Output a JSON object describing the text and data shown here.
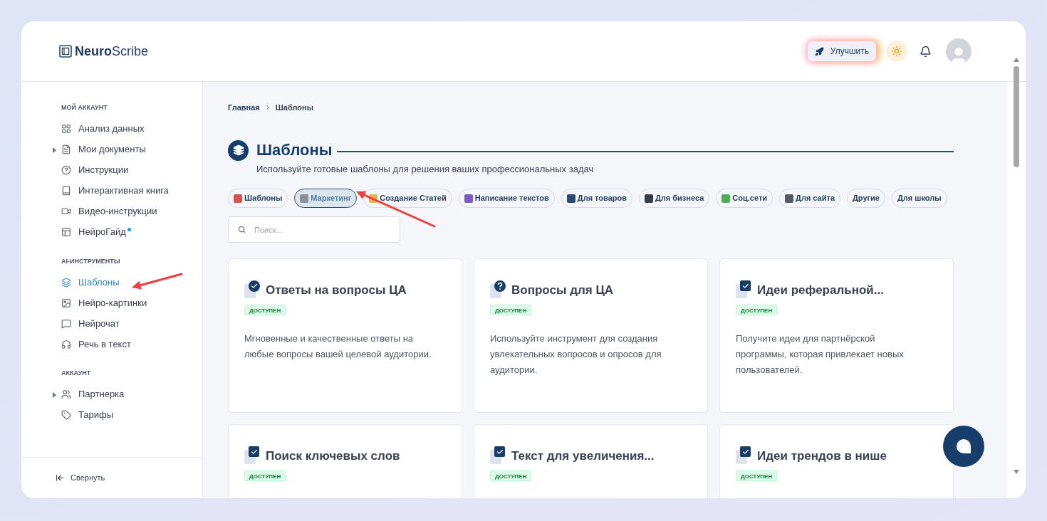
{
  "logo": {
    "bold": "Neuro",
    "light": "Scribe"
  },
  "header": {
    "upgrade_label": "Улучшить"
  },
  "sidebar": {
    "sections": [
      {
        "title": "МОЙ АККАУНТ",
        "items": [
          {
            "label": "Анализ данных",
            "kind": "grid",
            "selected": false,
            "expandable": false,
            "new_dot": false
          },
          {
            "label": "Мои документы",
            "kind": "file",
            "selected": false,
            "expandable": true,
            "new_dot": false
          },
          {
            "label": "Инструкции",
            "kind": "help",
            "selected": false,
            "expandable": false,
            "new_dot": false
          },
          {
            "label": "Интерактивная книга",
            "kind": "book",
            "selected": false,
            "expandable": false,
            "new_dot": false
          },
          {
            "label": "Видео-инструкции",
            "kind": "video",
            "selected": false,
            "expandable": false,
            "new_dot": false
          },
          {
            "label": "НейроГайд",
            "kind": "panel",
            "selected": false,
            "expandable": false,
            "new_dot": true
          }
        ]
      },
      {
        "title": "AI-ИНСТРУМЕНТЫ",
        "items": [
          {
            "label": "Шаблоны",
            "kind": "layers",
            "selected": true,
            "expandable": false,
            "new_dot": false
          },
          {
            "label": "Нейро-картинки",
            "kind": "image",
            "selected": false,
            "expandable": false,
            "new_dot": false
          },
          {
            "label": "Нейрочат",
            "kind": "chat",
            "selected": false,
            "expandable": false,
            "new_dot": false
          },
          {
            "label": "Речь в текст",
            "kind": "headphones",
            "selected": false,
            "expandable": false,
            "new_dot": false
          }
        ]
      },
      {
        "title": "АККАУНТ",
        "items": [
          {
            "label": "Партнерка",
            "kind": "users",
            "selected": false,
            "expandable": true,
            "new_dot": false
          },
          {
            "label": "Тарифы",
            "kind": "tag",
            "selected": false,
            "expandable": false,
            "new_dot": false
          }
        ]
      }
    ],
    "collapse_label": "Свернуть"
  },
  "breadcrumb": [
    "Главная",
    "Шаблоны"
  ],
  "page": {
    "title": "Шаблоны",
    "subtitle": "Используйте готовые шаблоны для решения ваших профессиональных задач"
  },
  "categories": [
    {
      "label": "Шаблоны",
      "selected": false,
      "color": "#d9534f"
    },
    {
      "label": "Маркетинг",
      "selected": true,
      "color": "#8a8f98"
    },
    {
      "label": "Создание Статей",
      "selected": false,
      "color": "#e0b84a"
    },
    {
      "label": "Написание текстов",
      "selected": false,
      "color": "#7a5cc7"
    },
    {
      "label": "Для товаров",
      "selected": false,
      "color": "#2d4a6e"
    },
    {
      "label": "Для бизнеса",
      "selected": false,
      "color": "#3a3f47"
    },
    {
      "label": "Соц.сети",
      "selected": false,
      "color": "#4caf50"
    },
    {
      "label": "Для сайта",
      "selected": false,
      "color": "#555b66"
    },
    {
      "label": "Другие",
      "selected": false
    },
    {
      "label": "Для школы",
      "selected": false
    }
  ],
  "search": {
    "placeholder": "Поиск..."
  },
  "cards": [
    {
      "title": "Ответы на вопросы ЦА",
      "kind": "check",
      "badge": "ДОСТУПЕН",
      "description": "Мгновенные и качественные ответы на любые вопросы вашей целевой аудитории."
    },
    {
      "title": "Вопросы для ЦА",
      "kind": "question",
      "badge": "ДОСТУПЕН",
      "description": "Используйте инструмент для создания увлекательных вопросов и опросов для аудитории."
    },
    {
      "title": "Идеи реферальной...",
      "kind": "checkbox",
      "badge": "ДОСТУПЕН",
      "description": "Получите идеи для партнёрской программы, которая привлекает новых пользователей."
    },
    {
      "title": "Поиск ключевых слов",
      "kind": "checkbox",
      "badge": "ДОСТУПЕН"
    },
    {
      "title": "Текст для увеличения...",
      "kind": "checkbox",
      "badge": "ДОСТУПЕН"
    },
    {
      "title": "Идеи трендов в нише",
      "kind": "checkbox",
      "badge": "ДОСТУПЕН"
    }
  ]
}
